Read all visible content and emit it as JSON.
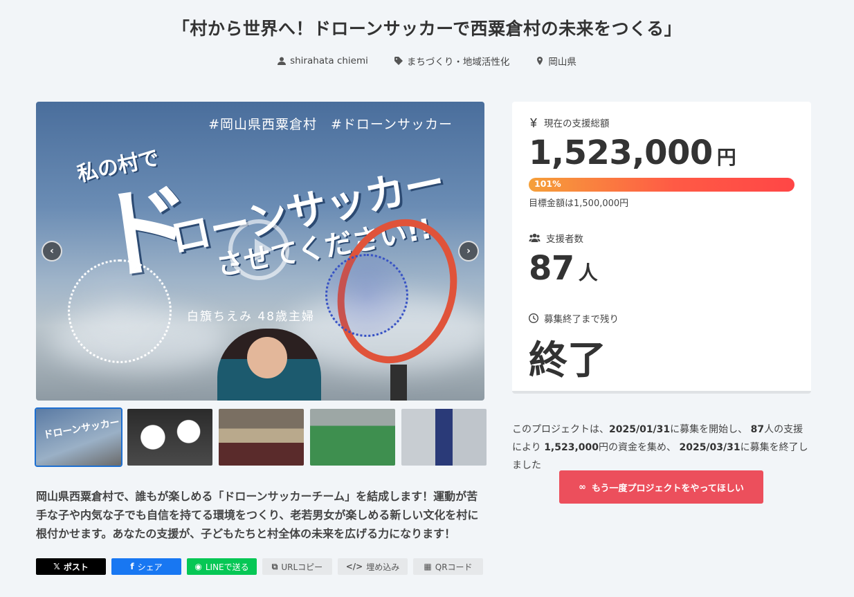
{
  "title": "「村から世界へ！ドローンサッカーで西粟倉村の未来をつくる」",
  "meta": {
    "author": "shirahata chiemi",
    "category": "まちづくり・地域活性化",
    "location": "岡山県"
  },
  "hero": {
    "hashtags": "#岡山県西粟倉村　#ドローンサッカー",
    "line1": "私の村で",
    "big": "ド",
    "line2": "ローンサッカー",
    "line3": "させてください!!",
    "person_caption": "白籏ちえみ 48歳主婦",
    "prev": "‹",
    "next": "›"
  },
  "thumbs": [
    {
      "caption": "ドローンサッカー"
    },
    {
      "caption": ""
    },
    {
      "caption": ""
    },
    {
      "caption": ""
    },
    {
      "caption": ""
    }
  ],
  "description": "岡山県西粟倉村で、誰もが楽しめる「ドローンサッカーチーム」を結成します！運動が苦手な子や内気な子でも自信を持てる環境をつくり、老若男女が楽しめる新しい文化を村に根付かせます。あなたの支援が、子どもたちと村全体の未来を広げる力になります！",
  "share": {
    "x": "ポスト",
    "x_icon": "𝕏",
    "facebook": "シェア",
    "facebook_icon": "f",
    "line": "LINEで送る",
    "line_icon": "◉",
    "url": "URLコピー",
    "url_icon": "⧉",
    "embed": "埋め込み",
    "embed_icon": "</>",
    "qr": "QRコード",
    "qr_icon": "▦"
  },
  "stats": {
    "amount_label": "現在の支援総額",
    "amount": "1,523,000",
    "amount_unit": "円",
    "progress_text": "101%",
    "progress_percent": 101,
    "goal": "目標金額は1,500,000円",
    "backers_label": "支援者数",
    "backers": "87",
    "backers_unit": "人",
    "remaining_label": "募集終了まで残り",
    "remaining": "終了"
  },
  "summary": {
    "p1": "このプロジェクトは、",
    "start": "2025/01/31",
    "p2": "に募集を開始し、",
    "backers": "87",
    "p3": "人の支援により",
    "amount": "1,523,000",
    "p4": "円の資金を集め、",
    "end": "2025/03/31",
    "p5": "に募集を終了しました"
  },
  "again_button": "もう一度プロジェクトをやってほしい",
  "again_icon": "∞",
  "colors": {
    "accent": "#ec4f5c",
    "progress_start": "#f5a03a",
    "progress_end": "#ff4646",
    "background": "#f2f5f8"
  }
}
